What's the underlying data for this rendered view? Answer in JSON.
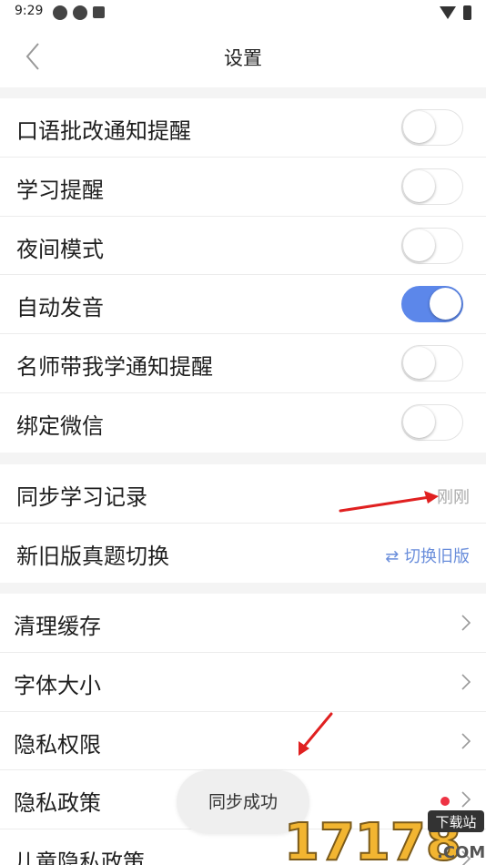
{
  "status_bar": {
    "time": "9:29"
  },
  "header": {
    "title": "设置"
  },
  "toggle_section": [
    {
      "label": "口语批改通知提醒",
      "on": false
    },
    {
      "label": "学习提醒",
      "on": false
    },
    {
      "label": "夜间模式",
      "on": false
    },
    {
      "label": "自动发音",
      "on": true
    },
    {
      "label": "名师带我学通知提醒",
      "on": false
    },
    {
      "label": "绑定微信",
      "on": false
    }
  ],
  "sync_section": {
    "sync_label": "同步学习记录",
    "sync_value": "刚刚",
    "switch_label": "新旧版真题切换",
    "switch_value": "⇄ 切换旧版"
  },
  "nav_section": [
    {
      "label": "清理缓存",
      "dot": false
    },
    {
      "label": "字体大小",
      "dot": false
    },
    {
      "label": "隐私权限",
      "dot": false
    },
    {
      "label": "隐私政策",
      "dot": true
    },
    {
      "label": "儿童隐私政策",
      "dot": false
    }
  ],
  "toast": {
    "text": "同步成功"
  },
  "watermark": {
    "logo_text": "17178",
    "badge_text": "下载站",
    "suffix": ".COM"
  },
  "colors": {
    "accent": "#5c87ea",
    "arrow": "#e02020",
    "dot": "#ee3344"
  }
}
